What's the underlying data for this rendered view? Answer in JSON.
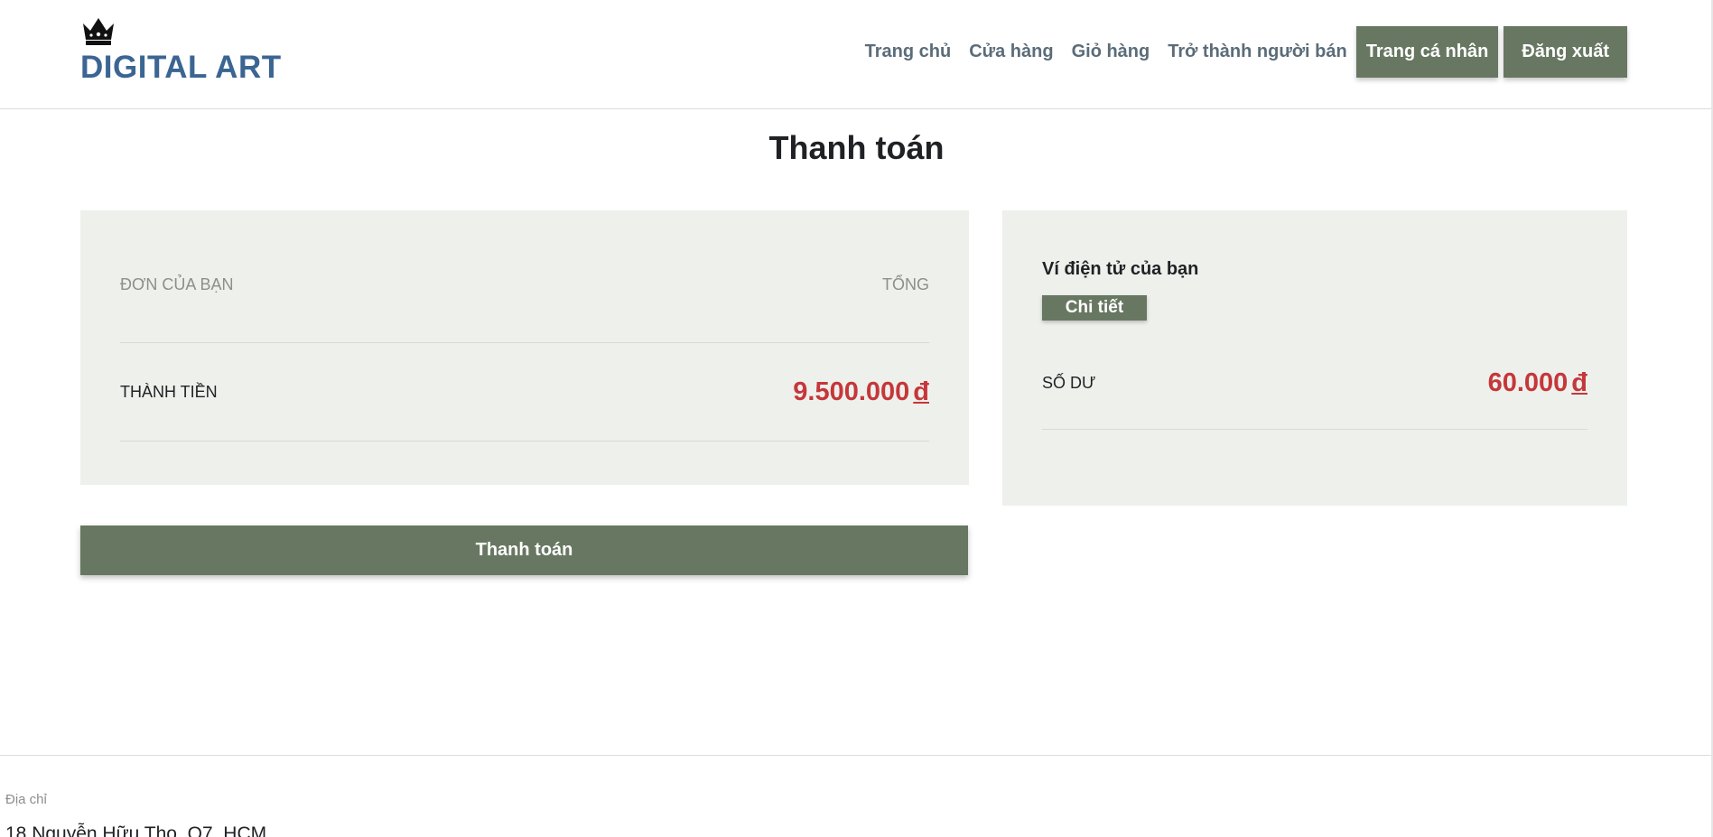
{
  "brand": {
    "logo_icon": "crown-icon",
    "name": "DIGITAL ART",
    "color": "#3b6592"
  },
  "nav": {
    "links": [
      "Trang chủ",
      "Cửa hàng",
      "Giỏ hàng",
      "Trở thành người bán"
    ],
    "profile_button": "Trang cá nhân",
    "logout_button": "Đăng xuất"
  },
  "page": {
    "title": "Thanh toán"
  },
  "order": {
    "header_left": "ĐƠN CỦA BẠN",
    "header_right": "TỔNG",
    "total_label": "THÀNH TIỀN",
    "total_value": "9.500.000",
    "currency": "đ"
  },
  "wallet": {
    "title": "Ví điện tử của bạn",
    "detail_button": "Chi tiết",
    "balance_label": "SỐ DƯ",
    "balance_value": "60.000",
    "currency": "đ"
  },
  "actions": {
    "pay_button": "Thanh toán"
  },
  "footer": {
    "address_label": "Địa chỉ",
    "address": "18 Nguyễn Hữu Thọ, Q7, HCM"
  },
  "colors": {
    "accent": "#687762",
    "price": "#c5373a",
    "card_bg": "#eef0ec"
  }
}
